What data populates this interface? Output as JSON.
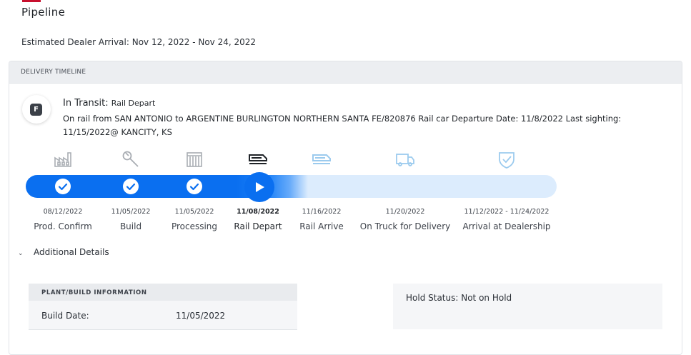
{
  "page": {
    "title": "Pipeline",
    "estimated_arrival": "Estimated Dealer Arrival: Nov 12, 2022 - Nov 24, 2022"
  },
  "timeline": {
    "header": "DELIVERY TIMELINE",
    "badge": "F",
    "status_title": "In Transit:",
    "status_subtitle": "Rail Depart",
    "status_description": "On rail from SAN ANTONIO to ARGENTINE BURLINGTON NORTHERN SANTA FE/820876 Rail car Departure Date: 11/8/2022 Last sighting: 11/15/2022@ KANCITY, KS",
    "steps": [
      {
        "label": "Prod. Confirm",
        "date": "08/12/2022",
        "icon": "factory-icon",
        "state": "complete"
      },
      {
        "label": "Build",
        "date": "11/05/2022",
        "icon": "wrench-icon",
        "state": "complete"
      },
      {
        "label": "Processing",
        "date": "11/05/2022",
        "icon": "processing-icon",
        "state": "complete"
      },
      {
        "label": "Rail Depart",
        "date": "11/08/2022",
        "icon": "rail-car-icon",
        "state": "current"
      },
      {
        "label": "Rail Arrive",
        "date": "11/16/2022",
        "icon": "rail-car-icon",
        "state": "upcoming"
      },
      {
        "label": "On Truck for Delivery",
        "date": "11/20/2022",
        "icon": "truck-icon",
        "state": "upcoming"
      },
      {
        "label": "Arrival at Dealership",
        "date": "11/12/2022 - 11/24/2022",
        "icon": "shield-check-icon",
        "state": "upcoming"
      }
    ],
    "colors": {
      "progress": "#0a6ff0",
      "track": "#dcecfd",
      "upcoming_icon": "#9ccbee",
      "complete_icon": "#a9adb3"
    }
  },
  "details": {
    "toggle_label": "Additional Details",
    "plant": {
      "header": "PLANT/BUILD INFORMATION",
      "build_date_label": "Build Date:",
      "build_date_value": "11/05/2022"
    },
    "hold_status": "Hold Status: Not on Hold"
  }
}
